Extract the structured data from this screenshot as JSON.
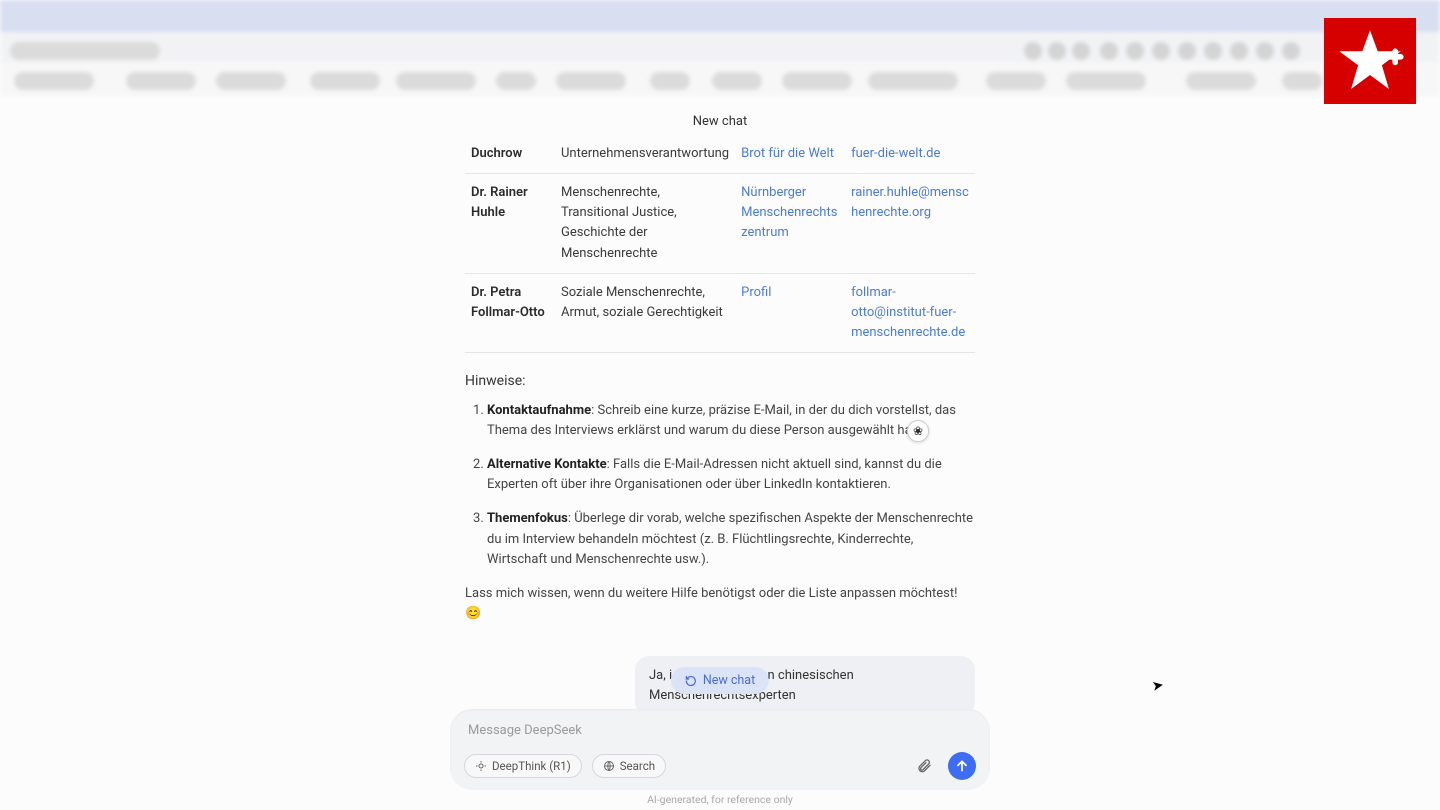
{
  "header": {
    "title": "New chat"
  },
  "table": {
    "rows": [
      {
        "name": "Duchrow",
        "topic": "Unternehmensverantwortung",
        "org": "Brot für die Welt",
        "link": "fuer-die-welt.de"
      },
      {
        "name": "Dr. Rainer Huhle",
        "topic": "Menschenrechte, Transitional Justice, Geschichte der Menschenrechte",
        "org": "Nürnberger Menschenrechtszentrum",
        "link": "rainer.huhle@menschenrechte.org"
      },
      {
        "name": "Dr. Petra Follmar-Otto",
        "topic": "Soziale Menschenrechte, Armut, soziale Gerechtigkeit",
        "org": "Profil",
        "link": "follmar-otto@institut-fuer-menschenrechte.de"
      }
    ]
  },
  "hinweise": {
    "title": "Hinweise:",
    "items": [
      {
        "label": "Kontaktaufnahme",
        "text": ": Schreib eine kurze, präzise E-Mail, in der du dich vorstellst, das Thema des Interviews erklärst und warum du diese Person ausgewählt hast."
      },
      {
        "label": "Alternative Kontakte",
        "text": ": Falls die E-Mail-Adressen nicht aktuell sind, kannst du die Experten oft über ihre Organisationen oder über LinkedIn kontaktieren."
      },
      {
        "label": "Themenfokus",
        "text": ": Überlege dir vorab, welche spezifischen Aspekte der Menschenrechte du im Interview behandeln möchtest (z. B. Flüchtlingsrechte, Kinderrechte, Wirtschaft und Menschenrechte usw.)."
      }
    ],
    "closing": "Lass mich wissen, wenn du weitere Hilfe benötigst oder die Liste anpassen möchtest! 😊"
  },
  "user_message": "Ja, ich bräuchte einen chinesischen Menschenrechtsexperten",
  "new_chat_pill": "New chat",
  "input": {
    "placeholder": "Message DeepSeek",
    "chip_deepthink": "DeepThink (R1)",
    "chip_search": "Search"
  },
  "footer": "AI-generated, for reference only",
  "badge_glyph": "❀"
}
